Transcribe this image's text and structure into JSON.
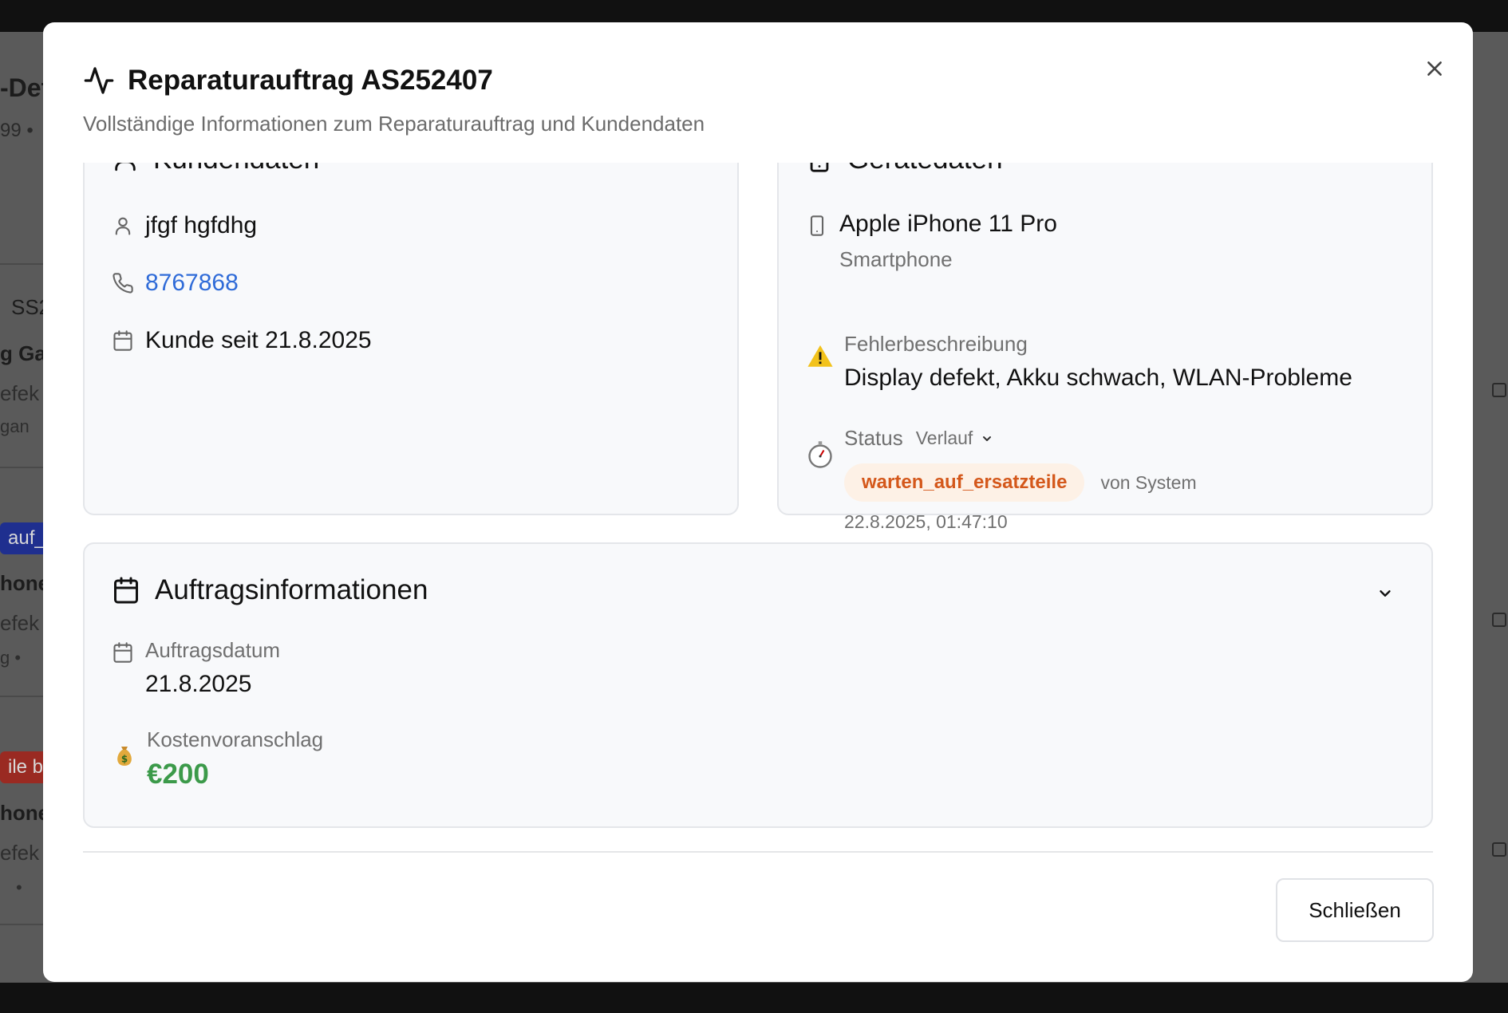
{
  "dialog": {
    "title": "Reparaturauftrag AS252407",
    "subtitle": "Vollständige Informationen zum Reparaturauftrag und Kundendaten",
    "close_icon": "x-icon"
  },
  "customer_card": {
    "title": "Kundendaten",
    "name": "jfgf hgfdhg",
    "phone": "8767868",
    "since": "Kunde seit 21.8.2025"
  },
  "device_card": {
    "title": "Gerätedaten",
    "device_name": "Apple iPhone 11 Pro",
    "device_type": "Smartphone",
    "fault_label": "Fehlerbeschreibung",
    "fault_text": "Display defekt, Akku schwach, WLAN-Probleme",
    "status_label": "Status",
    "history_toggle": "Verlauf",
    "status_badge": "warten_auf_ersatzteile",
    "status_by": "von System",
    "status_time": "22.8.2025, 01:47:10"
  },
  "order_card": {
    "title": "Auftragsinformationen",
    "date_label": "Auftragsdatum",
    "date_value": "21.8.2025",
    "estimate_label": "Kostenvoranschlag",
    "estimate_value": "€200"
  },
  "footer": {
    "close_label": "Schließen"
  },
  "background": {
    "title_fragment": "-Det",
    "sub_fragment": "99 •",
    "item1_code": "SS2",
    "item1_name": "g Gal",
    "item1_desc": "efek",
    "item1_meta": "gan",
    "item2_badge": "auf_",
    "item2_name": "hone",
    "item2_desc": "efek",
    "item2_meta": "g   •",
    "item3_badge": "ile b",
    "item3_name": "hone",
    "item3_desc": "efek",
    "item3_meta": "•"
  },
  "colors": {
    "link": "#2f6bd8",
    "status_badge_bg": "#fdf1e6",
    "status_badge_text": "#d4581b",
    "price": "#3c9a4a",
    "bg_badge_blue": "#1f2f8f",
    "bg_badge_red": "#9a2a22"
  }
}
